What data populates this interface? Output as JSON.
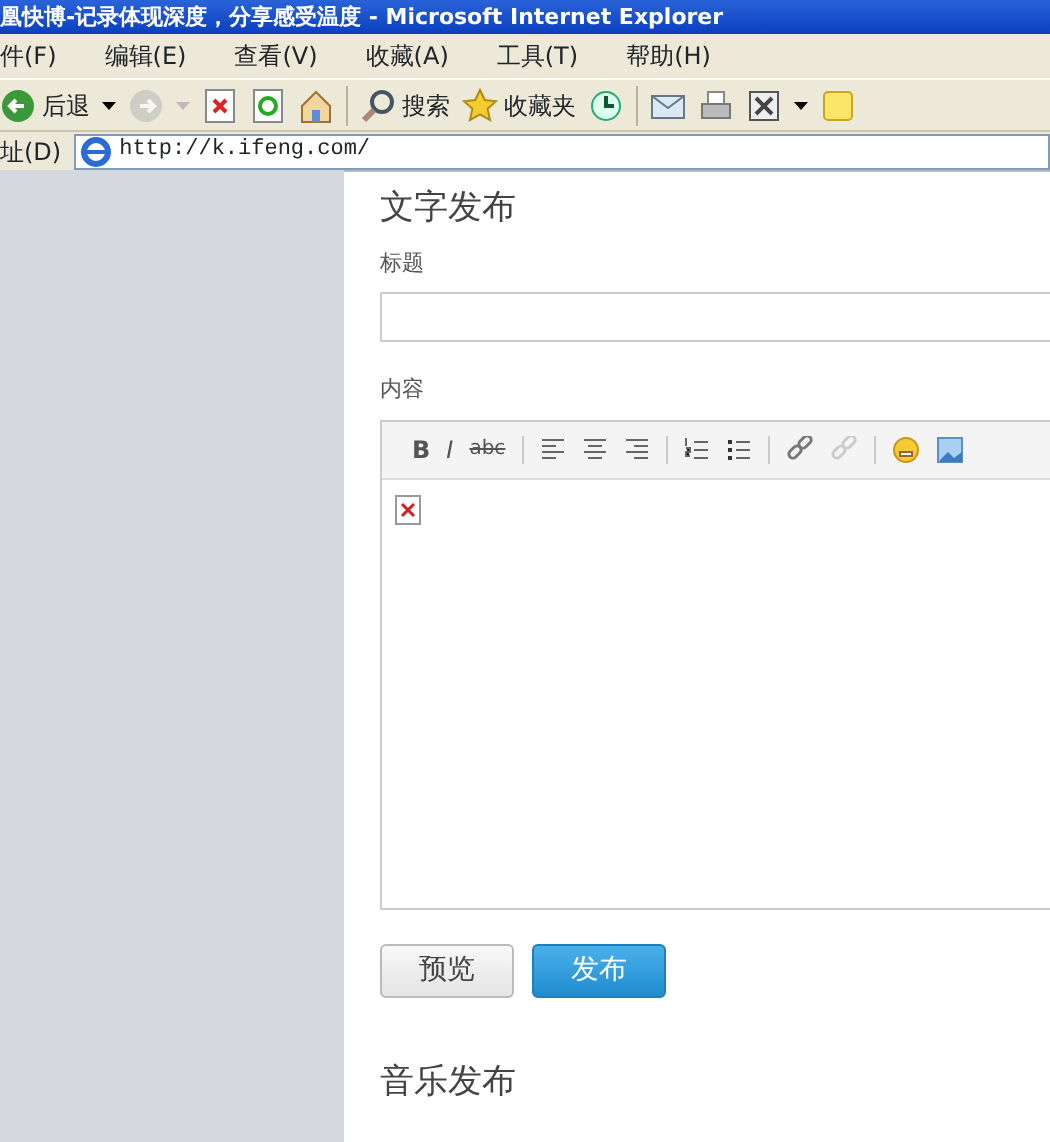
{
  "window": {
    "title": "凰快博-记录体现深度，分享感受温度 - Microsoft Internet Explorer"
  },
  "menu": [
    "件(F)",
    "编辑(E)",
    "查看(V)",
    "收藏(A)",
    "工具(T)",
    "帮助(H)"
  ],
  "toolbar": [
    {
      "kind": "back",
      "label": "后退"
    },
    {
      "kind": "dropdown"
    },
    {
      "kind": "forward",
      "disabled": true
    },
    {
      "kind": "dropdown",
      "disabled": true
    },
    {
      "kind": "stop"
    },
    {
      "kind": "refresh"
    },
    {
      "kind": "home"
    },
    {
      "kind": "sep"
    },
    {
      "kind": "search",
      "label": "搜索"
    },
    {
      "kind": "favorites",
      "label": "收藏夹"
    },
    {
      "kind": "history"
    },
    {
      "kind": "sep"
    },
    {
      "kind": "mail"
    },
    {
      "kind": "print"
    },
    {
      "kind": "edit"
    },
    {
      "kind": "dropdown"
    },
    {
      "kind": "note"
    }
  ],
  "address": {
    "label": "址(D)",
    "url": "http://k.ifeng.com/"
  },
  "text_post": {
    "heading": "文字发布",
    "title_label": "标题",
    "content_label": "内容",
    "editor_toolbar": [
      {
        "kind": "bold",
        "label": "B"
      },
      {
        "kind": "italic",
        "label": "I"
      },
      {
        "kind": "strike",
        "label": "abc"
      },
      {
        "kind": "sep"
      },
      {
        "kind": "align-left"
      },
      {
        "kind": "align-center"
      },
      {
        "kind": "align-right"
      },
      {
        "kind": "sep"
      },
      {
        "kind": "ordered-list"
      },
      {
        "kind": "bullet-list"
      },
      {
        "kind": "sep"
      },
      {
        "kind": "link",
        "disabled": false
      },
      {
        "kind": "unlink",
        "disabled": true
      },
      {
        "kind": "sep"
      },
      {
        "kind": "emoticon"
      },
      {
        "kind": "image"
      }
    ],
    "buttons": [
      {
        "label": "预览",
        "primary": false
      },
      {
        "label": "发布",
        "primary": true
      }
    ]
  },
  "music_post": {
    "heading": "音乐发布"
  }
}
